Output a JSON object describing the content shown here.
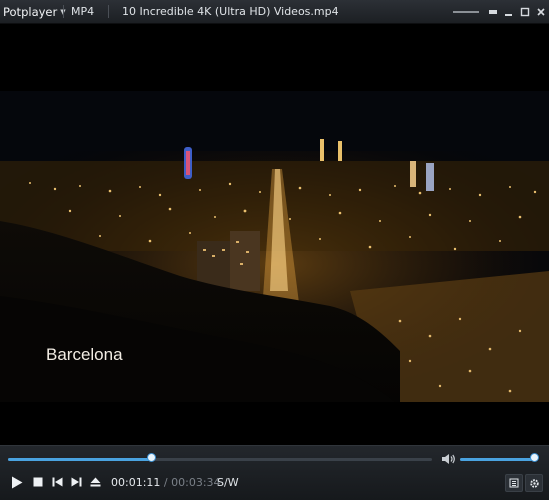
{
  "titlebar": {
    "app_name": "Potplayer",
    "format": "MP4",
    "file_title": "10 Incredible 4K (Ultra HD) Videos.mp4"
  },
  "video": {
    "caption": "Barcelona"
  },
  "playback": {
    "current_time": "00:01:11",
    "separator": "/",
    "total_time": "00:03:34",
    "mode_label": "S/W",
    "progress": 0.34,
    "volume": 0.96
  },
  "colors": {
    "accent": "#4aa3e0",
    "titlebar_bg": "#23272c",
    "controlbar_bg": "#1b1e22"
  },
  "icons": [
    "caret-down-icon",
    "pin-icon",
    "minimize-icon",
    "maximize-icon",
    "close-icon",
    "speaker-icon",
    "play-icon",
    "stop-icon",
    "previous-icon",
    "next-icon",
    "eject-icon",
    "playlist-icon",
    "settings-icon"
  ]
}
